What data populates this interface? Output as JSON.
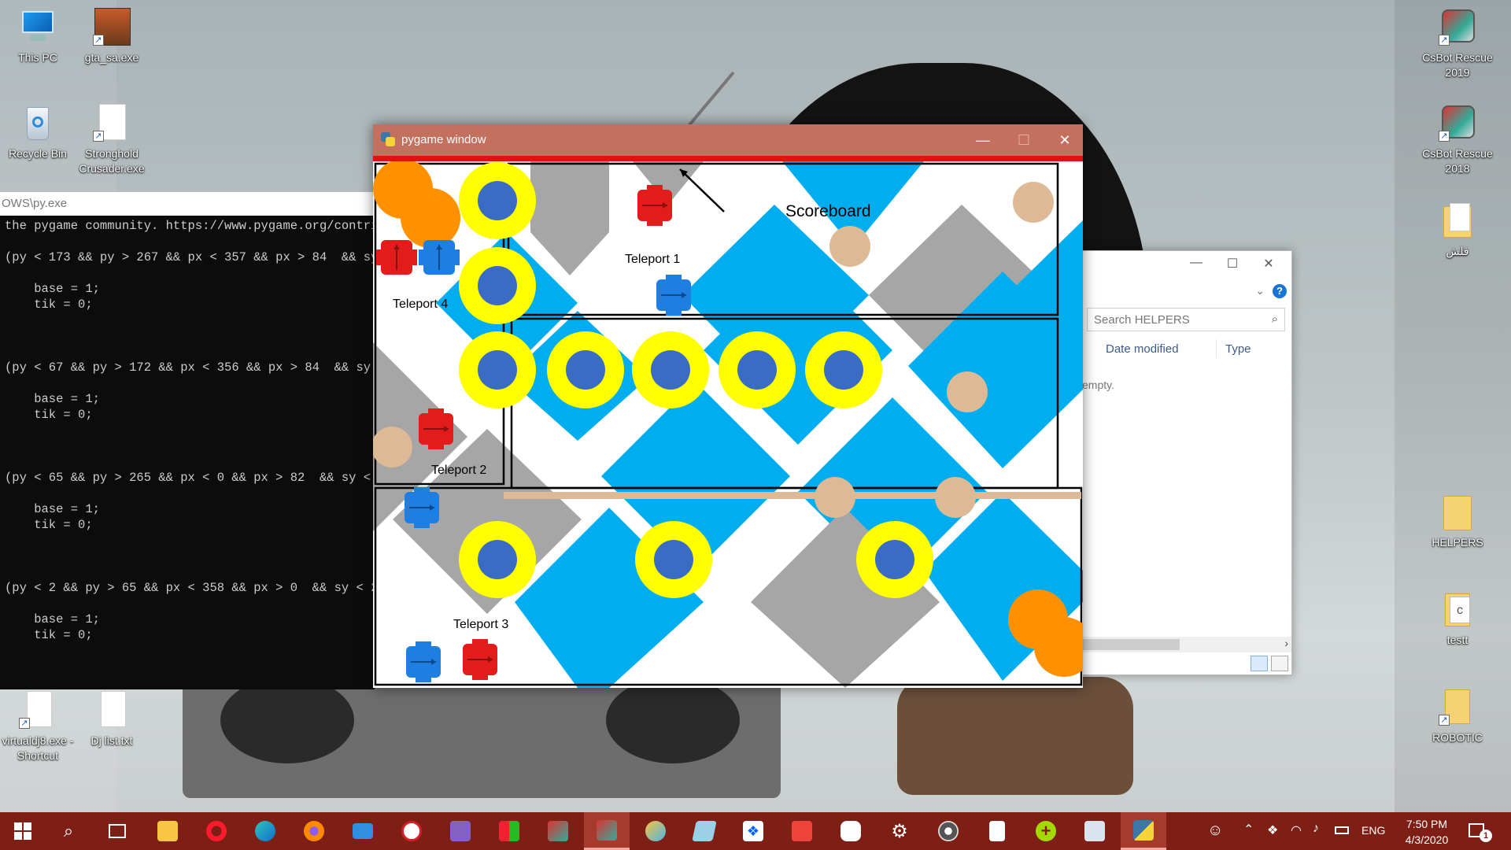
{
  "desktop": {
    "icons": [
      {
        "label": "This PC",
        "icon": "computer-icon"
      },
      {
        "label": "gta_sa.exe",
        "icon": "game-exe-icon"
      },
      {
        "label": "Recycle Bin",
        "icon": "recycle-bin-icon"
      },
      {
        "label": "Stronghold Crusader.exe",
        "icon": "file-icon"
      },
      {
        "label": "CsBot Rescue 2019",
        "icon": "csbot-icon"
      },
      {
        "label": "CsBot Rescue 2018",
        "icon": "csbot-icon"
      },
      {
        "label": "فلش",
        "icon": "folder-icon"
      },
      {
        "label": "HELPERS",
        "icon": "folder-icon"
      },
      {
        "label": "testt",
        "icon": "c-file-icon"
      },
      {
        "label": "ROBOTIC",
        "icon": "file-icon"
      },
      {
        "label": "virtualdj8.exe - Shortcut",
        "icon": "file-icon"
      },
      {
        "label": "Dj list.txt",
        "icon": "text-file-icon"
      }
    ]
  },
  "console": {
    "title": "OWS\\py.exe",
    "lines": [
      "the pygame community. https://www.pygame.org/contrib",
      "",
      "(py < 173 && py > 267 && px < 357 && px > 84  && sy",
      "",
      "    base = 1;",
      "    tik = 0;",
      "",
      "",
      "",
      "(py < 67 && py > 172 && px < 356 && px > 84  && sy <",
      "",
      "    base = 1;",
      "    tik = 0;",
      "",
      "",
      "",
      "(py < 65 && py > 265 && px < 0 && px > 82  && sy < 6",
      "",
      "    base = 1;",
      "    tik = 0;",
      "",
      "",
      "",
      "(py < 2 && py > 65 && px < 358 && px > 0  && sy < 2",
      "",
      "    base = 1;",
      "    tik = 0;"
    ]
  },
  "explorer": {
    "search_placeholder": "Search HELPERS",
    "col_date": "Date modified",
    "col_type": "Type",
    "empty_text": "empty."
  },
  "pygame": {
    "title": "pygame window",
    "labels": {
      "scoreboard": "Scoreboard",
      "teleport1": "Teleport 1",
      "teleport2": "Teleport 2",
      "teleport3": "Teleport 3",
      "teleport4": "Teleport 4"
    },
    "colors": {
      "blue_tile": "#00aeef",
      "gray_tile": "#a6a6a6",
      "yellow_ring": "#ffff00",
      "dot_blue": "#3b6cc4",
      "orange": "#ff9100",
      "tan": "#ddb996",
      "red_robot": "#e21b1b",
      "blue_robot": "#1e7fe0",
      "title_bar": "#c4705e",
      "red_bar": "#e21010"
    }
  },
  "taskbar": {
    "apps": [
      "start-icon",
      "search-icon",
      "task-view-icon",
      "file-explorer-icon",
      "opera-icon",
      "edge-icon",
      "firefox-icon",
      "mail-icon",
      "huawei-icon",
      "visual-studio-icon",
      "app-grid-icon",
      "csbot-icon",
      "csbot-icon",
      "paint-icon",
      "notepad-icon",
      "dropbox-icon",
      "anydesk-icon",
      "discord-icon",
      "settings-icon",
      "media-icon",
      "calculator-icon",
      "plus-app-icon",
      "user-folder-icon",
      "python-icon"
    ],
    "language": "ENG",
    "time": "7:50 PM",
    "date": "4/3/2020",
    "notification_count": "1"
  }
}
